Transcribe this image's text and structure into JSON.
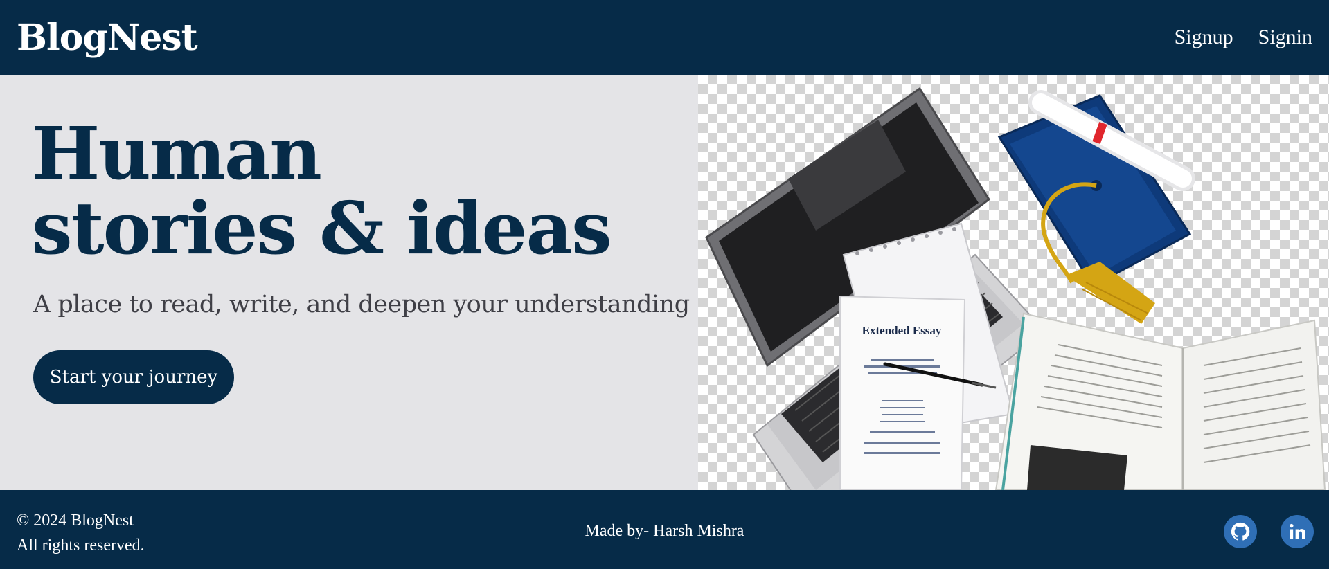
{
  "header": {
    "brand": "BlogNest",
    "nav": {
      "signup": "Signup",
      "signin": "Signin"
    }
  },
  "hero": {
    "headline_line1": "Human",
    "headline_line2": "stories & ideas",
    "subheadline": "A place to read, write, and deepen your understanding",
    "cta_label": "Start your journey",
    "image": {
      "essay_title": "Extended Essay"
    }
  },
  "footer": {
    "copyright": "© 2024 BlogNest",
    "rights": "All rights reserved.",
    "made_by": "Made by- Harsh Mishra",
    "social": [
      {
        "name": "github",
        "icon": "github-icon"
      },
      {
        "name": "linkedin",
        "icon": "linkedin-icon"
      }
    ]
  },
  "colors": {
    "brand_navy": "#062b48",
    "hero_bg": "#e4e4e7",
    "social_blue": "#2f6fb6"
  }
}
